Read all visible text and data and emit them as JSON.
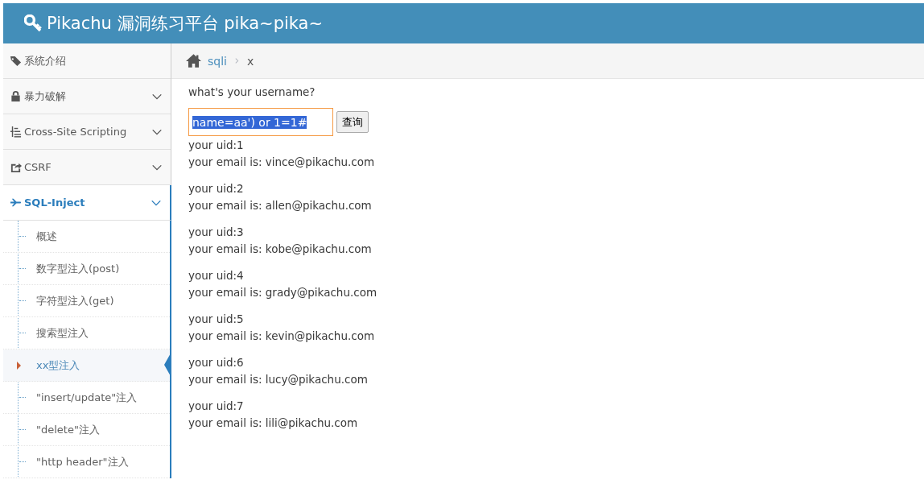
{
  "header": {
    "title": "Pikachu 漏洞练习平台 pika~pika~"
  },
  "sidebar": {
    "items": [
      {
        "label": "系统介绍",
        "kind": "link",
        "selected": false
      },
      {
        "label": "暴力破解",
        "kind": "menu",
        "selected": false
      },
      {
        "label": "Cross-Site Scripting",
        "kind": "menu",
        "selected": false
      },
      {
        "label": "CSRF",
        "kind": "menu",
        "selected": false
      },
      {
        "label": "SQL-Inject",
        "kind": "menu",
        "selected": true,
        "children": [
          {
            "label": "概述",
            "selected": false
          },
          {
            "label": "数字型注入(post)",
            "selected": false
          },
          {
            "label": "字符型注入(get)",
            "selected": false
          },
          {
            "label": "搜索型注入",
            "selected": false
          },
          {
            "label": "xx型注入",
            "selected": true
          },
          {
            "label": "\"insert/update\"注入",
            "selected": false
          },
          {
            "label": "\"delete\"注入",
            "selected": false
          },
          {
            "label": "\"http header\"注入",
            "selected": false
          }
        ]
      }
    ]
  },
  "breadcrumb": [
    "sqli",
    "x"
  ],
  "form": {
    "question": "what's your username?",
    "value": "name=aa') or 1=1#",
    "text_selected": true,
    "button": "查询"
  },
  "results": [
    {
      "uid": "your uid:1",
      "email": "your email is: vince@pikachu.com"
    },
    {
      "uid": "your uid:2",
      "email": "your email is: allen@pikachu.com"
    },
    {
      "uid": "your uid:3",
      "email": "your email is: kobe@pikachu.com"
    },
    {
      "uid": "your uid:4",
      "email": "your email is: grady@pikachu.com"
    },
    {
      "uid": "your uid:5",
      "email": "your email is: kevin@pikachu.com"
    },
    {
      "uid": "your uid:6",
      "email": "your email is: lucy@pikachu.com"
    },
    {
      "uid": "your uid:7",
      "email": "your email is: lili@pikachu.com"
    }
  ]
}
